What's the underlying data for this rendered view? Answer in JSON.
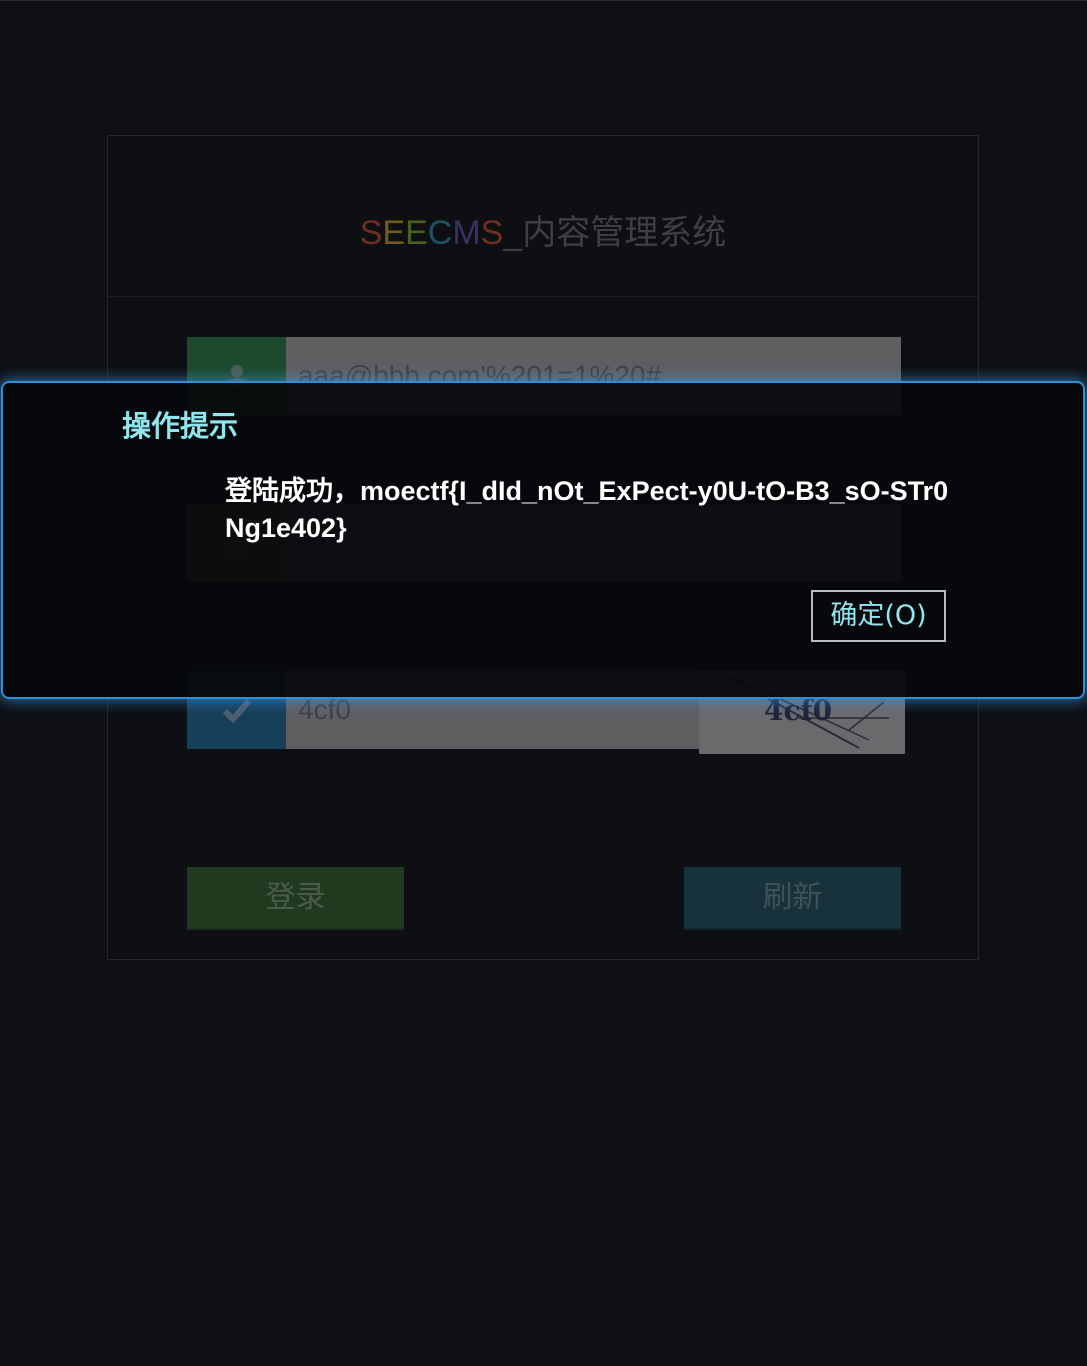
{
  "login": {
    "brand": [
      "S",
      "E",
      "E",
      "C",
      "M",
      "S",
      "_内容管理系统"
    ],
    "username_value": "aaa@bbb.com'%201=1%20#",
    "password_value": "•••",
    "captcha_value": "4cf0",
    "captcha_image_text": "4cf0",
    "login_button": "登录",
    "refresh_button": "刷新",
    "colors": {
      "user_icon_bg": "#1c4a2c",
      "lock_icon_bg": "#6a4a1c",
      "check_icon_bg": "#163f5a",
      "field_bg": "#5f5f61"
    }
  },
  "dialog": {
    "title": "操作提示",
    "message": "登陆成功，moectf{I_dId_nOt_ExPect-y0U-tO-B3_sO-STr0Ng1e402}",
    "ok_button": "确定(O)",
    "border_color": "#2f8fd6",
    "title_color": "#8fe6ee"
  },
  "icons": [
    "user-icon",
    "lock-icon",
    "check-icon"
  ]
}
